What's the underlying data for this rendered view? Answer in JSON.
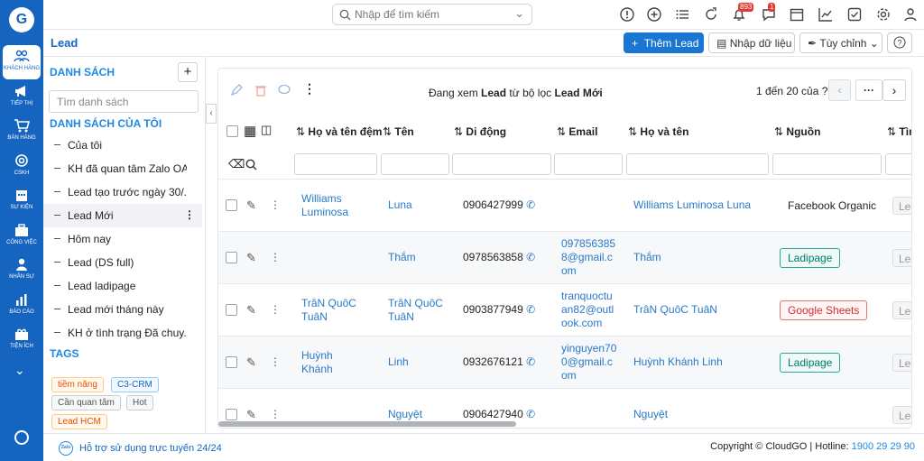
{
  "rail": {
    "items": [
      {
        "label": "Khách hàng",
        "icon": "users-icon"
      },
      {
        "label": "Tiếp thị",
        "icon": "megaphone-icon"
      },
      {
        "label": "Bán hàng",
        "icon": "cart-icon"
      },
      {
        "label": "CSKH",
        "icon": "lifebuoy-icon"
      },
      {
        "label": "Sự kiện",
        "icon": "calendar-icon"
      },
      {
        "label": "Công việc",
        "icon": "briefcase-icon"
      },
      {
        "label": "Nhân sự",
        "icon": "person-icon"
      },
      {
        "label": "Báo cáo",
        "icon": "chart-icon"
      },
      {
        "label": "Tiện ích",
        "icon": "gift-icon"
      }
    ]
  },
  "topbar": {
    "search_placeholder": "Nhập để tìm kiếm",
    "notifications_count": "893",
    "messages_count": "1"
  },
  "subbar": {
    "title": "Lead",
    "add_label": "Thêm Lead",
    "import_label": "Nhập dữ liệu",
    "custom_label": "Tùy chỉnh"
  },
  "left": {
    "list_title": "DANH SÁCH",
    "search_placeholder": "Tìm danh sách",
    "my_lists_title": "DANH SÁCH CỦA TÔI",
    "items": [
      "Của tôi",
      "KH đã quan tâm Zalo OA",
      "Lead tạo trước ngày 30/...",
      "Lead Mới",
      "Hôm nay",
      "Lead (DS full)",
      "Lead ladipage",
      "Lead mới tháng này",
      "KH ở tình trạng Đã chuy..."
    ],
    "tags_title": "TAGS",
    "tags": [
      "tiềm năng",
      "C3-CRM",
      "Cần quan tâm",
      "Hot",
      "Lead HCM"
    ]
  },
  "table": {
    "view_prefix": "Đang xem",
    "view_module": "Lead",
    "view_mid": "từ bộ lọc",
    "view_filter": "Lead Mới",
    "pagination": "1 đến 20 của",
    "pagination_q": "?",
    "columns": [
      "Họ và tên đệm",
      "Tên",
      "Di động",
      "Email",
      "Họ và tên",
      "Nguồn",
      "Tìn"
    ],
    "rows": [
      {
        "middle": "Williams Luminosa",
        "first": "Luna",
        "mobile": "0906427999",
        "email": "",
        "full": "Williams Luminosa Luna",
        "source": "Facebook Organic",
        "source_style": "plain",
        "extra": "Lea"
      },
      {
        "middle": "",
        "first": "Thắm",
        "mobile": "0978563858",
        "email": "0978563858@gmail.com",
        "full": "Thắm",
        "source": "Ladipage",
        "source_style": "teal",
        "extra": "Lea"
      },
      {
        "middle": "TrâN QuôC TuâN",
        "first": "TrâN QuôC TuâN",
        "mobile": "0903877949",
        "email": "tranquoctuan82@outlook.com",
        "full": "TrâN QuôC TuâN",
        "source": "Google Sheets",
        "source_style": "red",
        "extra": "Lea"
      },
      {
        "middle": "Huỳnh Khánh",
        "first": "Linh",
        "mobile": "0932676121",
        "email": "yinguyen700@gmail.com",
        "full": "Huỳnh Khánh Linh",
        "source": "Ladipage",
        "source_style": "teal",
        "extra": "Lea"
      },
      {
        "middle": "",
        "first": "Nguyệt",
        "mobile": "0906427940",
        "email": "",
        "full": "Nguyệt",
        "source": "",
        "source_style": "plain",
        "extra": "Lea"
      }
    ]
  },
  "footer": {
    "support": "Hỗ trợ sử dụng trực tuyến 24/24",
    "copyright": "Copyright © CloudGO | Hotline:",
    "hotline": "1900 29 29 90",
    "zalo_label": "Zalo"
  },
  "colors": {
    "brand": "#1565c0",
    "accent": "#1976d2",
    "link": "#2979c9",
    "teal": "#26a69a",
    "red": "#e57373"
  }
}
